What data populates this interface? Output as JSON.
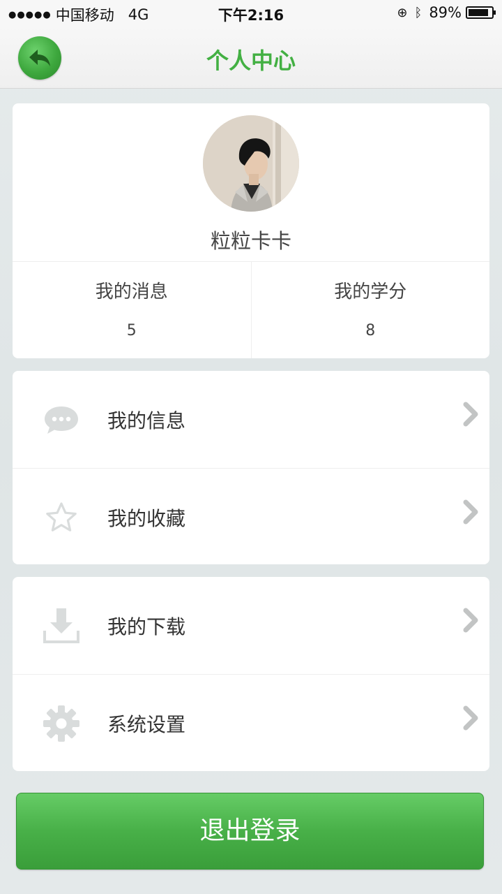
{
  "status_bar": {
    "signal": "●●●●●",
    "carrier": "中国移动",
    "network": "4G",
    "time": "下午2:16",
    "battery_pct": "89%",
    "battery_level": 0.89
  },
  "nav": {
    "title": "个人中心",
    "back_icon": "back-arrow-icon"
  },
  "profile": {
    "username": "粒粒卡卡",
    "stats": [
      {
        "label": "我的消息",
        "value": "5"
      },
      {
        "label": "我的学分",
        "value": "8"
      }
    ]
  },
  "menu": {
    "group1": [
      {
        "label": "我的信息",
        "icon": "chat-bubble-icon"
      },
      {
        "label": "我的收藏",
        "icon": "star-icon"
      }
    ],
    "group2": [
      {
        "label": "我的下载",
        "icon": "download-icon"
      },
      {
        "label": "系统设置",
        "icon": "gear-icon"
      }
    ]
  },
  "logout": {
    "label": "退出登录"
  },
  "colors": {
    "accent": "#43b043",
    "icon_gray": "#d9dcdc",
    "chevron_gray": "#c2c4c4"
  }
}
